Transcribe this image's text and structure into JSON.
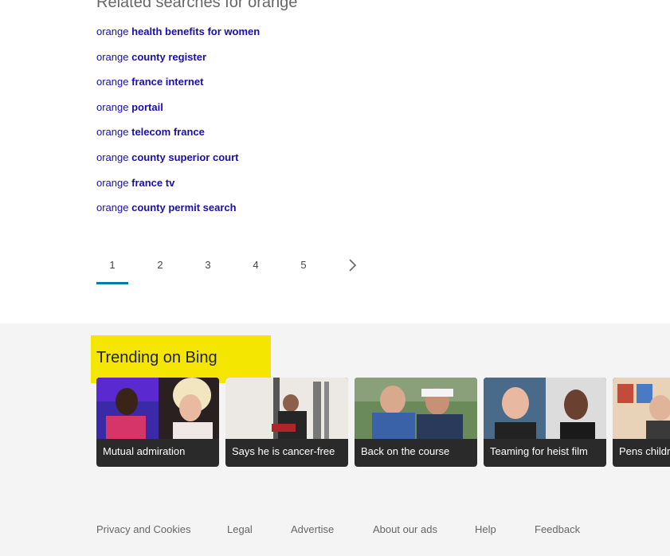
{
  "related": {
    "title": "Related searches for orange",
    "items": [
      {
        "query": "orange",
        "suffix": "health benefits for women"
      },
      {
        "query": "orange",
        "suffix": "county register"
      },
      {
        "query": "orange",
        "suffix": "france internet"
      },
      {
        "query": "orange",
        "suffix": "portail"
      },
      {
        "query": "orange",
        "suffix": "telecom france"
      },
      {
        "query": "orange",
        "suffix": "county superior court"
      },
      {
        "query": "orange",
        "suffix": "france tv"
      },
      {
        "query": "orange",
        "suffix": "county permit search"
      }
    ]
  },
  "pagination": {
    "pages": [
      "1",
      "2",
      "3",
      "4",
      "5"
    ],
    "current": "1",
    "accent": "#007daa"
  },
  "trending": {
    "title": "Trending on Bing",
    "highlight": "#f4e600",
    "cards": [
      {
        "caption": "Mutual admiration"
      },
      {
        "caption": "Says he is cancer-free"
      },
      {
        "caption": "Back on the course"
      },
      {
        "caption": "Teaming for heist film"
      },
      {
        "caption": "Pens children's book"
      }
    ]
  },
  "footer": {
    "links": [
      "Privacy and Cookies",
      "Legal",
      "Advertise",
      "About our ads",
      "Help",
      "Feedback"
    ]
  }
}
